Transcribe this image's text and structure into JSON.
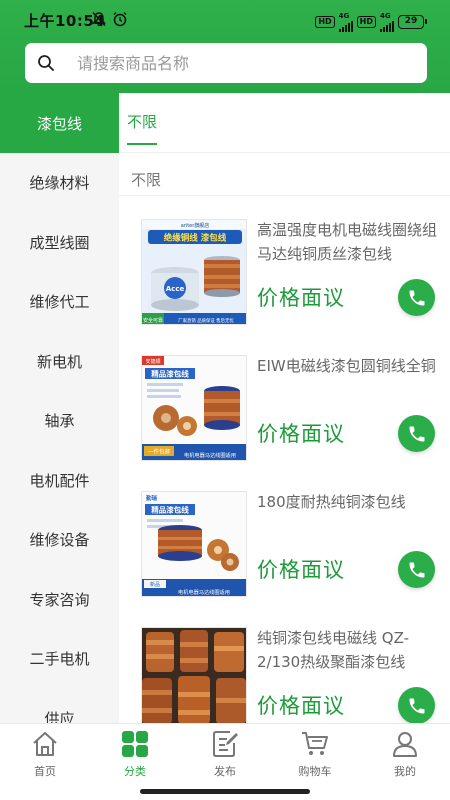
{
  "status_bar": {
    "time": "上午10:54",
    "hd1": "HD",
    "net1": "4G",
    "hd2": "HD",
    "net2": "4G",
    "battery": "29"
  },
  "search": {
    "placeholder": "请搜索商品名称"
  },
  "sidebar": {
    "items": [
      {
        "label": "漆包线"
      },
      {
        "label": "绝缘材料"
      },
      {
        "label": "成型线圈"
      },
      {
        "label": "维修代工"
      },
      {
        "label": "新电机"
      },
      {
        "label": "轴承"
      },
      {
        "label": "电机配件"
      },
      {
        "label": "维修设备"
      },
      {
        "label": "专家咨询"
      },
      {
        "label": "二手电机"
      },
      {
        "label": "供应"
      }
    ],
    "active_index": 0
  },
  "main": {
    "tab_label": "不限",
    "filter_label": "不限"
  },
  "products": [
    {
      "title": "高温强度电机电磁线圈绕组马达纯铜质丝漆包线",
      "price": "价格面议",
      "img_banner": "绝缘铜线 漆包线",
      "img_brand": "ariter旗舰店",
      "img_footer1": "安全可靠",
      "img_footer2": "厂家直销  品质保证  售后无忧"
    },
    {
      "title": "EIW电磁线漆包圆铜线全铜",
      "price": "价格面议",
      "img_banner": "精品漆包线",
      "img_tag": "安捷顺",
      "img_footer1": "一件包邮",
      "img_footer2": "电机电器马达线圈适用"
    },
    {
      "title": "180度耐热纯铜漆包线",
      "price": "价格面议",
      "img_banner": "精品漆包线",
      "img_tag": "勤瑞",
      "img_footer1": "新品",
      "img_footer2": "电机电器马达线圈适用"
    },
    {
      "title": "纯铜漆包线电磁线 QZ-2/130热级聚酯漆包线",
      "price": "价格面议"
    }
  ],
  "bottom_nav": [
    {
      "label": "首页",
      "icon": "home-icon"
    },
    {
      "label": "分类",
      "icon": "category-icon"
    },
    {
      "label": "发布",
      "icon": "edit-document-icon"
    },
    {
      "label": "购物车",
      "icon": "cart-icon"
    },
    {
      "label": "我的",
      "icon": "user-icon"
    }
  ],
  "colors": {
    "brand_green": "#28a745",
    "price_green": "#1f9a3a",
    "sidebar_bg": "#f5f5f5"
  }
}
